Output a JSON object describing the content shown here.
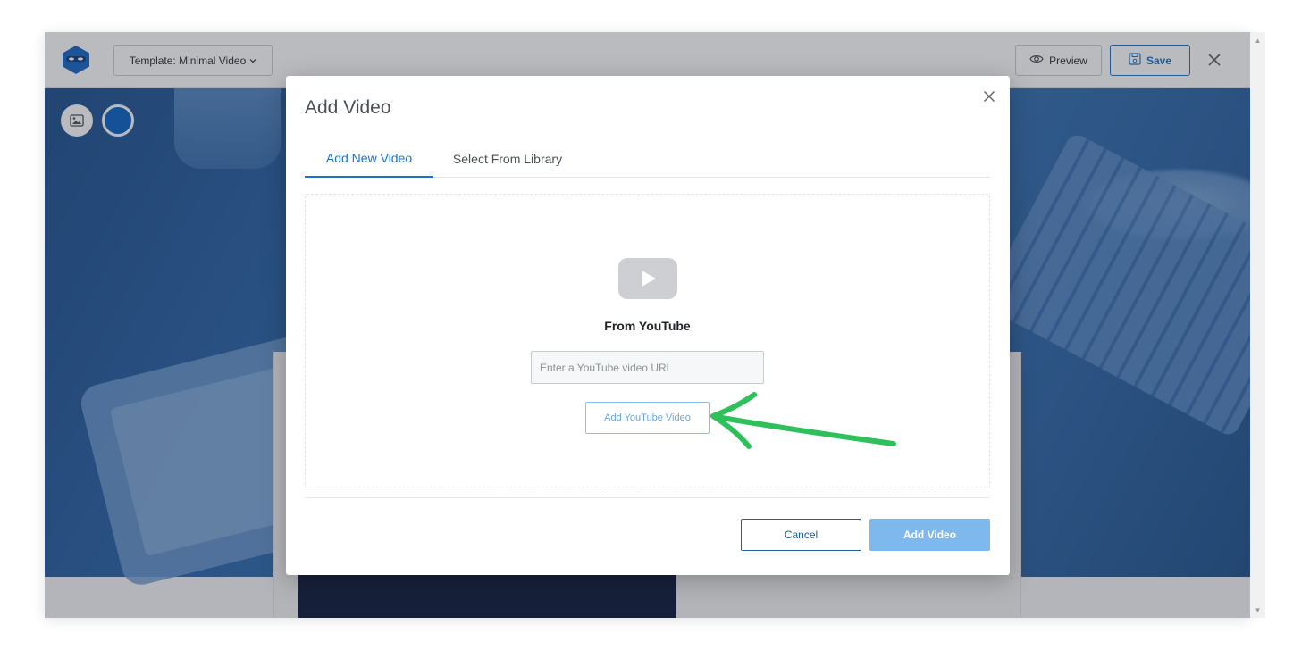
{
  "editor": {
    "template_label": "Template: Minimal Video",
    "preview_label": "Preview",
    "save_label": "Save"
  },
  "modal": {
    "title": "Add Video",
    "tabs": [
      {
        "label": "Add New Video",
        "active": true
      },
      {
        "label": "Select From Library",
        "active": false
      }
    ],
    "source_label": "From YouTube",
    "url_input": {
      "placeholder": "Enter a YouTube video URL",
      "value": ""
    },
    "add_youtube_label": "Add YouTube Video",
    "cancel_label": "Cancel",
    "add_video_label": "Add Video"
  },
  "icons": {
    "logo": "ninja-logo-icon",
    "template_dropdown": "chevron-down-icon",
    "preview": "eye-icon",
    "save": "floppy-disk-icon",
    "close": "close-icon",
    "background_image": "image-icon",
    "background_color": "color-swatch-icon",
    "youtube": "youtube-play-icon"
  },
  "colors": {
    "accent": "#1a73c9",
    "add_video_disabled": "#7fb8ec",
    "annotation_arrow": "#2ec05a",
    "hero_tint": "#2d69ad"
  }
}
